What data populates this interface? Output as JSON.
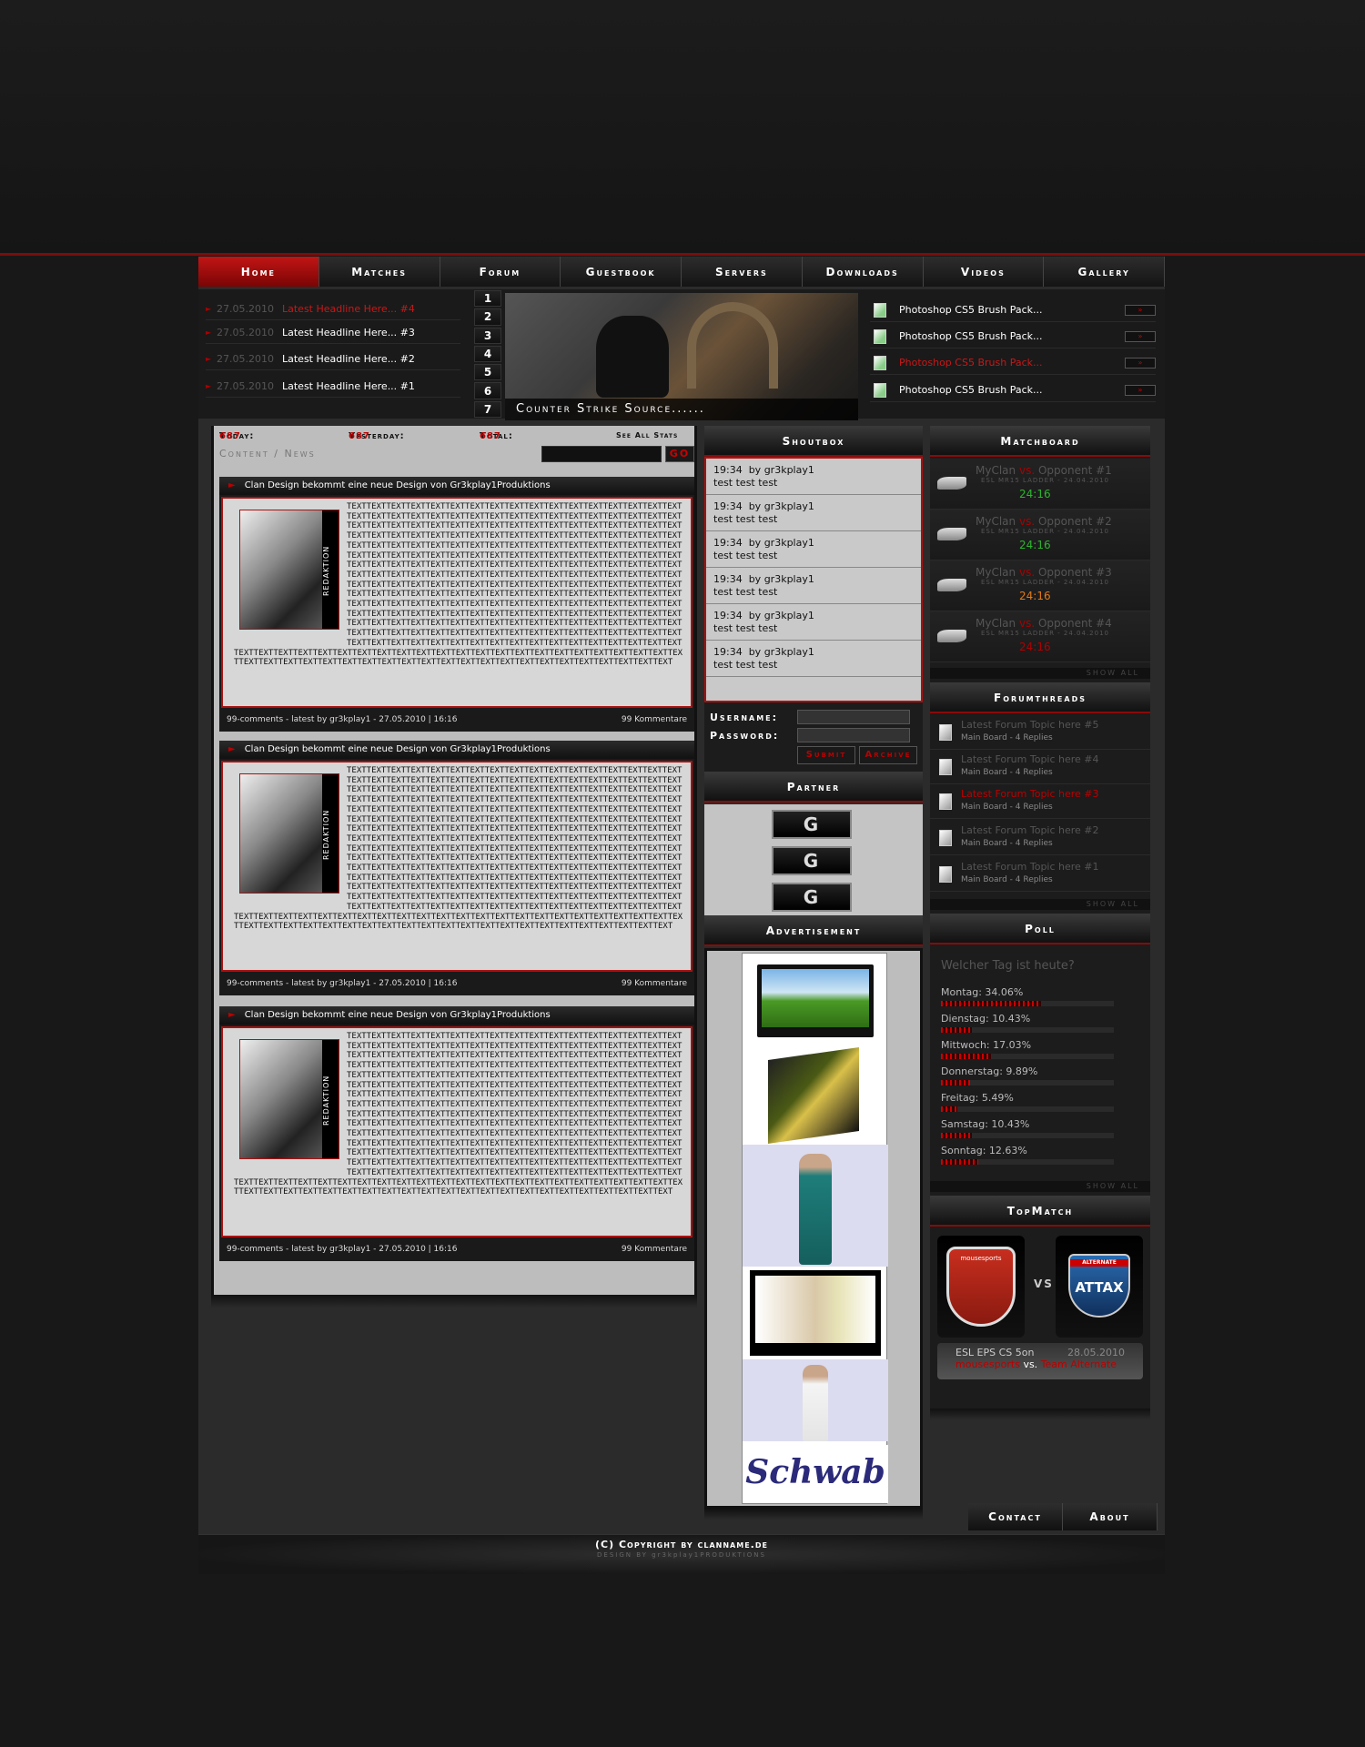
{
  "nav": [
    "Home",
    "Matches",
    "Forum",
    "Guestbook",
    "Servers",
    "Downloads",
    "Videos",
    "Gallery"
  ],
  "headlines": [
    {
      "date": "27.05.2010",
      "title": "Latest Headline Here... #4",
      "active": true
    },
    {
      "date": "27.05.2010",
      "title": "Latest Headline Here... #3",
      "active": false
    },
    {
      "date": "27.05.2010",
      "title": "Latest Headline Here... #2",
      "active": false
    },
    {
      "date": "27.05.2010",
      "title": "Latest Headline Here... #1",
      "active": false
    }
  ],
  "slider": {
    "numbers": [
      "1",
      "2",
      "3",
      "4",
      "5",
      "6",
      "7"
    ],
    "caption": "Counter Strike Source......"
  },
  "downloads": [
    {
      "title": "Photoshop CS5 Brush Pack...",
      "active": false
    },
    {
      "title": "Photoshop CS5 Brush Pack...",
      "active": false
    },
    {
      "title": "Photoshop CS5 Brush Pack...",
      "active": true
    },
    {
      "title": "Photoshop CS5 Brush Pack...",
      "active": false
    }
  ],
  "stats": {
    "today_label": "Today:",
    "today": "687",
    "yesterday_label": "Yesterday:",
    "yesterday": "687",
    "total_label": "Total:",
    "total": "687",
    "see_all": "See All Stats"
  },
  "crumb": "Content / News",
  "search_go": "GO",
  "news": [
    {
      "title": "Clan Design bekommt eine neue Design von Gr3kplay1Produktions",
      "img_label": "REDAKTION",
      "footer_left": "99-comments - latest by gr3kplay1 - 27.05.2010 | 16:16",
      "footer_right": "99 Kommentare"
    },
    {
      "title": "Clan Design bekommt eine neue Design von Gr3kplay1Produktions",
      "img_label": "REDAKTION",
      "footer_left": "99-comments - latest by gr3kplay1 - 27.05.2010 | 16:16",
      "footer_right": "99 Kommentare"
    },
    {
      "title": "Clan Design bekommt eine neue Design von Gr3kplay1Produktions",
      "img_label": "REDAKTION",
      "footer_left": "99-comments - latest by gr3kplay1 - 27.05.2010 | 16:16",
      "footer_right": "99 Kommentare"
    }
  ],
  "news_text": "TEXTTEXTTEXTTEXTTEXTTEXTTEXTTEXTTEXTTEXTTEXTTEXTTEXTTEXTTEXT",
  "shoutbox": {
    "title": "Shoutbox",
    "entries": [
      {
        "time": "19:34",
        "by": "by gr3kplay1",
        "msg": "test test test"
      },
      {
        "time": "19:34",
        "by": "by gr3kplay1",
        "msg": "test test test"
      },
      {
        "time": "19:34",
        "by": "by gr3kplay1",
        "msg": "test test test"
      },
      {
        "time": "19:34",
        "by": "by gr3kplay1",
        "msg": "test test test"
      },
      {
        "time": "19:34",
        "by": "by gr3kplay1",
        "msg": "test test test"
      },
      {
        "time": "19:34",
        "by": "by gr3kplay1",
        "msg": "test test test"
      }
    ],
    "username_label": "Username:",
    "password_label": "Password:",
    "submit": "Submit",
    "archive": "Archive"
  },
  "partner": {
    "title": "Partner",
    "logo_text": "G"
  },
  "advertisement": {
    "title": "Advertisement",
    "brand": "Schwab"
  },
  "matchboard": {
    "title": "Matchboard",
    "matches": [
      {
        "us": "MyClan",
        "vs": "vs.",
        "them": "Opponent #1",
        "league": "ESL MR15 LADDER - 24.04.2010",
        "score": "24:16",
        "color": "#2db52d"
      },
      {
        "us": "MyClan",
        "vs": "vs.",
        "them": "Opponent #2",
        "league": "ESL MR15 LADDER - 24.04.2010",
        "score": "24:16",
        "color": "#2db52d"
      },
      {
        "us": "MyClan",
        "vs": "vs.",
        "them": "Opponent #3",
        "league": "ESL MR15 LADDER - 24.04.2010",
        "score": "24:16",
        "color": "#e07a1a"
      },
      {
        "us": "MyClan",
        "vs": "vs.",
        "them": "Opponent #4",
        "league": "ESL MR15 LADDER - 24.04.2010",
        "score": "24:16",
        "color": "#b00000"
      }
    ],
    "show_all": "SHOW ALL"
  },
  "forum": {
    "title": "Forumthreads",
    "threads": [
      {
        "title": "Latest Forum Topic here #5",
        "sub": "Main Board  - 4 Replies",
        "active": false
      },
      {
        "title": "Latest Forum Topic here #4",
        "sub": "Main Board  - 4 Replies",
        "active": false
      },
      {
        "title": "Latest Forum Topic here #3",
        "sub": "Main Board  - 4 Replies",
        "active": true
      },
      {
        "title": "Latest Forum Topic here #2",
        "sub": "Main Board  - 4 Replies",
        "active": false
      },
      {
        "title": "Latest Forum Topic here #1",
        "sub": "Main Board  - 4 Replies",
        "active": false
      }
    ],
    "show_all": "SHOW ALL"
  },
  "poll": {
    "title": "Poll",
    "question": "Welcher Tag ist heute?",
    "options": [
      {
        "label": "Montag: 34.06%",
        "pct": 34.06
      },
      {
        "label": "Dienstag: 10.43%",
        "pct": 10.43
      },
      {
        "label": "Mittwoch: 17.03%",
        "pct": 17.03
      },
      {
        "label": "Donnerstag: 9.89%",
        "pct": 9.89
      },
      {
        "label": "Freitag: 5.49%",
        "pct": 5.49
      },
      {
        "label": "Samstag: 10.43%",
        "pct": 10.43
      },
      {
        "label": "Sonntag: 12.63%",
        "pct": 12.63
      }
    ],
    "show_all": "SHOW ALL"
  },
  "topmatch": {
    "title": "TopMatch",
    "team1": "mousesports",
    "team2": "ALTERNATE",
    "team2_logo": "ATTAX",
    "vs": "VS",
    "league": "ESL EPS CS 5on",
    "date": "28.05.2010",
    "team1_link": "mousesports",
    "vs_short": "vs.",
    "team2_link": "Team Alternate"
  },
  "contact": [
    "Contact",
    "About"
  ],
  "footer": {
    "copyright": "(C) Copyright by clanname.de",
    "design": "DESIGN BY gr3kplay1PRODUKTIONS"
  }
}
